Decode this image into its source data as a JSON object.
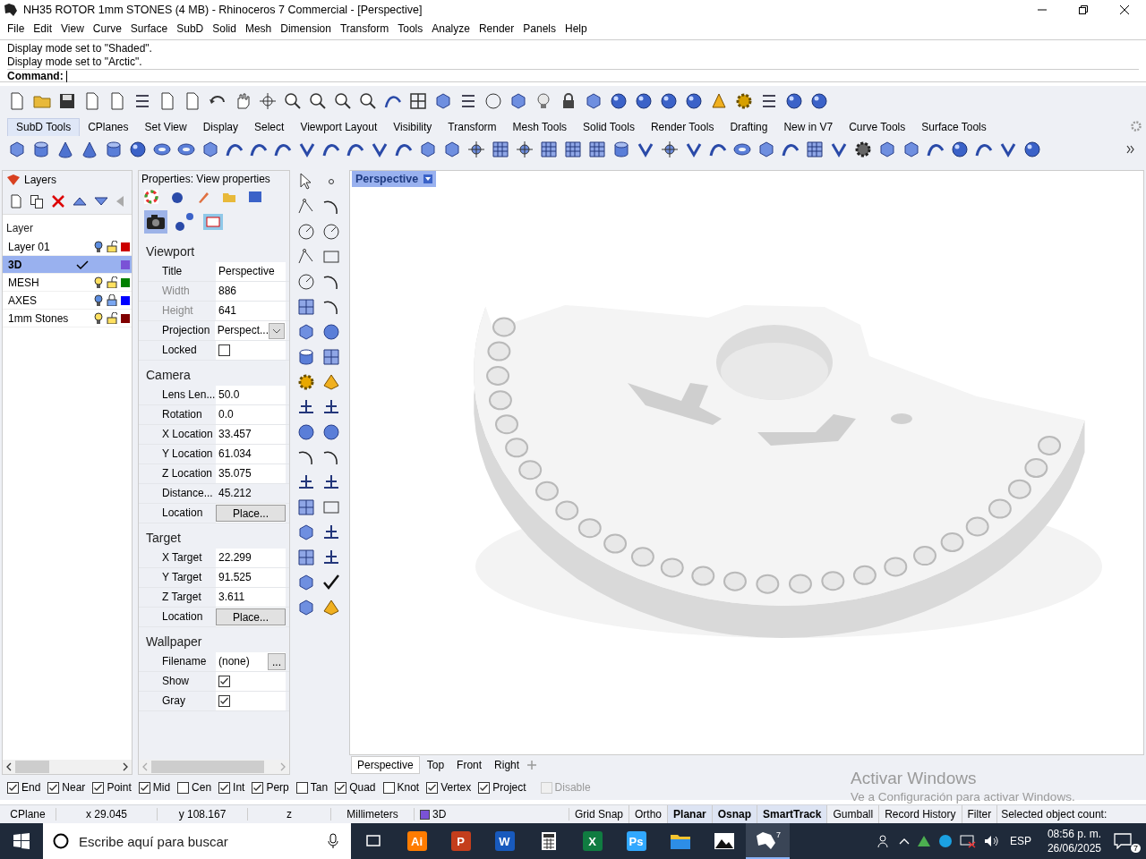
{
  "window": {
    "title": "NH35 ROTOR 1mm STONES (4 MB) - Rhinoceros 7 Commercial - [Perspective]"
  },
  "menu": [
    "File",
    "Edit",
    "View",
    "Curve",
    "Surface",
    "SubD",
    "Solid",
    "Mesh",
    "Dimension",
    "Transform",
    "Tools",
    "Analyze",
    "Render",
    "Panels",
    "Help"
  ],
  "command_history": [
    "Display mode set to \"Shaded\".",
    "Display mode set to \"Arctic\"."
  ],
  "command": {
    "label": "Command:"
  },
  "toolbar_tabs": [
    {
      "label": "SubD Tools",
      "selected": true
    },
    {
      "label": "CPlanes",
      "selected": false
    },
    {
      "label": "Set View",
      "selected": false
    },
    {
      "label": "Display",
      "selected": false
    },
    {
      "label": "Select",
      "selected": false
    },
    {
      "label": "Viewport Layout",
      "selected": false
    },
    {
      "label": "Visibility",
      "selected": false
    },
    {
      "label": "Transform",
      "selected": false
    },
    {
      "label": "Mesh Tools",
      "selected": false
    },
    {
      "label": "Solid Tools",
      "selected": false
    },
    {
      "label": "Render Tools",
      "selected": false
    },
    {
      "label": "Drafting",
      "selected": false
    },
    {
      "label": "New in V7",
      "selected": false
    },
    {
      "label": "Curve Tools",
      "selected": false
    },
    {
      "label": "Surface Tools",
      "selected": false
    }
  ],
  "layers": {
    "title": "Layers",
    "header": "Layer",
    "rows": [
      {
        "name": "Layer 01",
        "selected": false,
        "current": false,
        "visible": false,
        "locked": false,
        "color": "#cc0000"
      },
      {
        "name": "3D",
        "selected": true,
        "current": true,
        "color": "#7a52d6"
      },
      {
        "name": "MESH",
        "selected": false,
        "current": false,
        "visible": true,
        "locked": false,
        "color": "#008000"
      },
      {
        "name": "AXES",
        "selected": false,
        "current": false,
        "visible": false,
        "locked": true,
        "color": "#0000ff"
      },
      {
        "name": "1mm Stones",
        "selected": false,
        "current": false,
        "visible": true,
        "locked": false,
        "color": "#800000"
      }
    ]
  },
  "properties": {
    "title": "Properties: View properties",
    "sections": [
      {
        "title": "Viewport",
        "rows": [
          {
            "label": "Title",
            "value": "Perspective",
            "kind": "text",
            "disabled": false
          },
          {
            "label": "Width",
            "value": "886",
            "kind": "text",
            "disabled": true
          },
          {
            "label": "Height",
            "value": "641",
            "kind": "text",
            "disabled": true
          },
          {
            "label": "Projection",
            "value": "Perspect...",
            "kind": "dropdown",
            "disabled": false
          },
          {
            "label": "Locked",
            "kind": "checkbox",
            "checked": false,
            "disabled": false
          }
        ]
      },
      {
        "title": "Camera",
        "rows": [
          {
            "label": "Lens Len...",
            "value": "50.0",
            "kind": "text",
            "disabled": false
          },
          {
            "label": "Rotation",
            "value": "0.0",
            "kind": "text",
            "disabled": false
          },
          {
            "label": "X Location",
            "value": "33.457",
            "kind": "text",
            "disabled": false
          },
          {
            "label": "Y Location",
            "value": "61.034",
            "kind": "text",
            "disabled": false
          },
          {
            "label": "Z Location",
            "value": "35.075",
            "kind": "text",
            "disabled": false
          },
          {
            "label": "Distance...",
            "value": "45.212",
            "kind": "readonly",
            "disabled": false
          },
          {
            "label": "Location",
            "value": "Place...",
            "kind": "button",
            "disabled": false
          }
        ]
      },
      {
        "title": "Target",
        "rows": [
          {
            "label": "X Target",
            "value": "22.299",
            "kind": "text",
            "disabled": false
          },
          {
            "label": "Y Target",
            "value": "91.525",
            "kind": "text",
            "disabled": false
          },
          {
            "label": "Z Target",
            "value": "3.611",
            "kind": "text",
            "disabled": false
          },
          {
            "label": "Location",
            "value": "Place...",
            "kind": "button",
            "disabled": false
          }
        ]
      },
      {
        "title": "Wallpaper",
        "rows": [
          {
            "label": "Filename",
            "value": "(none)",
            "kind": "browse",
            "button": "...",
            "disabled": false
          },
          {
            "label": "Show",
            "kind": "checkbox",
            "checked": true,
            "disabled": false
          },
          {
            "label": "Gray",
            "kind": "checkbox",
            "checked": true,
            "disabled": false
          }
        ]
      }
    ]
  },
  "viewport": {
    "title": "Perspective"
  },
  "viewport_tabs": [
    {
      "label": "Perspective",
      "selected": true
    },
    {
      "label": "Top",
      "selected": false
    },
    {
      "label": "Front",
      "selected": false
    },
    {
      "label": "Right",
      "selected": false
    }
  ],
  "osnaps": [
    {
      "label": "End",
      "checked": true,
      "disabled": false
    },
    {
      "label": "Near",
      "checked": true,
      "disabled": false
    },
    {
      "label": "Point",
      "checked": true,
      "disabled": false
    },
    {
      "label": "Mid",
      "checked": true,
      "disabled": false
    },
    {
      "label": "Cen",
      "checked": false,
      "disabled": false
    },
    {
      "label": "Int",
      "checked": true,
      "disabled": false
    },
    {
      "label": "Perp",
      "checked": true,
      "disabled": false
    },
    {
      "label": "Tan",
      "checked": false,
      "disabled": false
    },
    {
      "label": "Quad",
      "checked": true,
      "disabled": false
    },
    {
      "label": "Knot",
      "checked": false,
      "disabled": false
    },
    {
      "label": "Vertex",
      "checked": true,
      "disabled": false
    },
    {
      "label": "Project",
      "checked": true,
      "disabled": false
    },
    {
      "label": "Disable",
      "checked": false,
      "disabled": true
    }
  ],
  "status_bar": {
    "cplane": "CPlane",
    "x": "x 29.045",
    "y": "y 108.167",
    "z": "z",
    "units": "Millimeters",
    "layer": {
      "name": "3D",
      "color": "#7a52d6"
    },
    "toggles": [
      {
        "label": "Grid Snap",
        "on": false
      },
      {
        "label": "Ortho",
        "on": false
      },
      {
        "label": "Planar",
        "on": true
      },
      {
        "label": "Osnap",
        "on": true
      },
      {
        "label": "SmartTrack",
        "on": true
      },
      {
        "label": "Gumball",
        "on": false
      },
      {
        "label": "Record History",
        "on": false
      },
      {
        "label": "Filter",
        "on": false
      }
    ],
    "message": "Selected object count:"
  },
  "activation": {
    "title": "Activar Windows",
    "subtitle": "Ve a Configuración para activar Windows."
  },
  "taskbar": {
    "search": {
      "placeholder": "Escribe aquí para buscar"
    },
    "apps": [
      {
        "kind": "taskview",
        "selected": false
      },
      {
        "kind": "letter",
        "label": "Ai",
        "color": "#ff7c00",
        "selected": false
      },
      {
        "kind": "letter",
        "label": "P",
        "color": "#c43e1c",
        "selected": false
      },
      {
        "kind": "letter",
        "label": "W",
        "color": "#185abd",
        "selected": false
      },
      {
        "kind": "calculator",
        "selected": false
      },
      {
        "kind": "letter",
        "label": "X",
        "color": "#107c41",
        "selected": false
      },
      {
        "kind": "letter",
        "label": "Ps",
        "color": "#31a8ff",
        "selected": false
      },
      {
        "kind": "folder",
        "selected": false
      },
      {
        "kind": "photos",
        "selected": false
      },
      {
        "kind": "rhino",
        "label": "7",
        "selected": true
      }
    ],
    "language": "ESP",
    "time": "08:56 p. m.",
    "date": "26/06/2025",
    "notifications": "7"
  }
}
